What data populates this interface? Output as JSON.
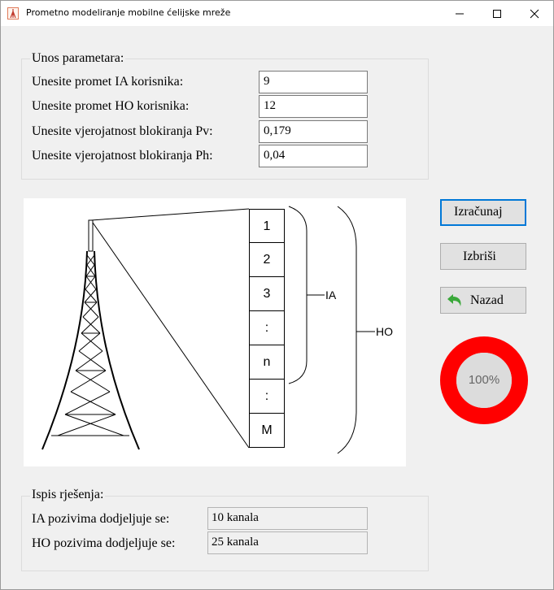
{
  "window": {
    "title": "Prometno modeliranje mobilne ćelijske mreže"
  },
  "input_group": {
    "title": "Unos parametara:",
    "rows": [
      {
        "label": "Unesite promet IA korisnika:",
        "value": "9"
      },
      {
        "label": "Unesite promet HO korisnika:",
        "value": "12"
      },
      {
        "label": "Unesite vjerojatnost blokiranja Pv:",
        "value": "0,179"
      },
      {
        "label": "Unesite vjerojatnost blokiranja Ph:",
        "value": "0,04"
      }
    ]
  },
  "diagram": {
    "channels": [
      "1",
      "2",
      "3",
      ":",
      "n",
      ":",
      "M"
    ],
    "ia_label": "IA",
    "ho_label": "HO"
  },
  "buttons": {
    "calculate": "Izračunaj",
    "clear": "Izbriši",
    "back": "Nazad"
  },
  "progress": {
    "text": "100%",
    "value": 1.0,
    "ring_color": "#ff0000",
    "inner_color": "#dcdcdc"
  },
  "output_group": {
    "title": "Ispis rješenja:",
    "rows": [
      {
        "label": "IA pozivima dodjeljuje se:",
        "value": "10 kanala"
      },
      {
        "label": "HO pozivima dodjeljuje se:",
        "value": "25 kanala"
      }
    ]
  },
  "colors": {
    "accent": "#0078d7",
    "back_arrow": "#3aa83a"
  }
}
